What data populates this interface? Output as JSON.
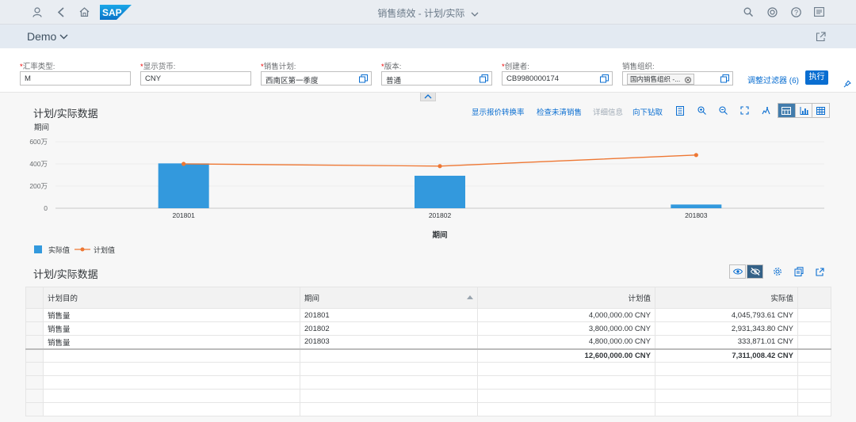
{
  "shell": {
    "title": "销售绩效 - 计划/实际",
    "logo_text": "SAP",
    "icons": [
      "user-icon",
      "back-icon",
      "home-icon",
      "search-icon",
      "notifications-icon",
      "help-icon",
      "me-area-icon"
    ]
  },
  "page": {
    "variant_title": "Demo"
  },
  "filters": {
    "fields": [
      {
        "label": "汇率类型:",
        "value": "M",
        "required": true
      },
      {
        "label": "显示货币:",
        "value": "CNY",
        "required": true
      },
      {
        "label": "销售计划:",
        "value": "西南区第一季度",
        "required": true
      },
      {
        "label": "版本:",
        "value": "普通",
        "required": true
      },
      {
        "label": "创建者:",
        "value": "CB9980000174",
        "required": true
      },
      {
        "label": "销售组织:",
        "value": "国内销售组织 -...",
        "required": false
      }
    ],
    "adapt_filters_label": "调整过滤器 (6)",
    "go_label": "执行"
  },
  "chart_panel": {
    "title": "计划/实际数据",
    "actions": [
      "显示报价转换率",
      "检查未清销售",
      "详细信息",
      "向下钻取"
    ]
  },
  "chart_data": {
    "type": "bar",
    "title": "",
    "categories": [
      "201801",
      "201802",
      "201803"
    ],
    "series": [
      {
        "name": "实际值",
        "type": "bar",
        "color": "#3399dd",
        "values": [
          4045793.61,
          2931343.8,
          333871.01
        ]
      },
      {
        "name": "计划值",
        "type": "line",
        "color": "#ee7733",
        "values": [
          4000000.0,
          3800000.0,
          4800000.0
        ]
      }
    ],
    "xlabel": "期间",
    "ylabel": "",
    "dimension_label": "期间",
    "ylim": [
      0,
      6000000
    ],
    "yticks": [
      "0",
      "200万",
      "400万",
      "600万"
    ],
    "legend_position": "bottom-left",
    "grid": true
  },
  "table": {
    "title": "计划/实际数据",
    "columns": [
      "计划目的",
      "期间",
      "计划值",
      "实际值"
    ],
    "rows": [
      [
        "销售量",
        "201801",
        "4,000,000.00  CNY",
        "4,045,793.61  CNY"
      ],
      [
        "销售量",
        "201802",
        "3,800,000.00  CNY",
        "2,931,343.80  CNY"
      ],
      [
        "销售量",
        "201803",
        "4,800,000.00  CNY",
        "333,871.01  CNY"
      ]
    ],
    "total": [
      "",
      "",
      "12,600,000.00  CNY",
      "7,311,008.42  CNY"
    ]
  },
  "colors": {
    "accent": "#0a6ed1",
    "bar": "#3399dd",
    "line": "#ee7733",
    "shell_bg": "#e9edf2"
  }
}
